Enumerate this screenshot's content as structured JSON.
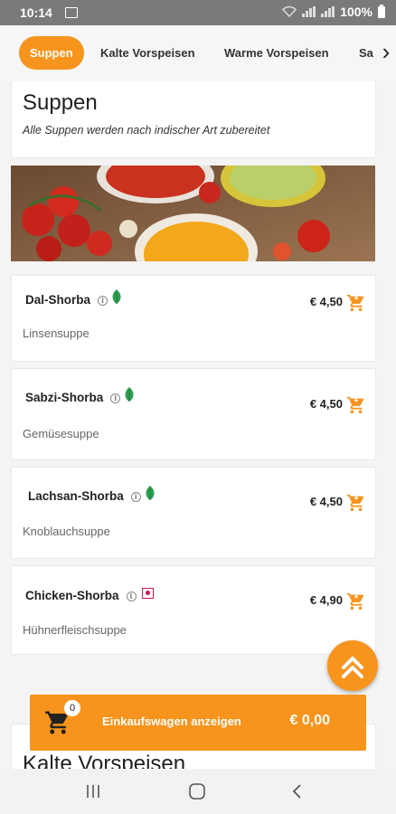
{
  "status": {
    "time": "10:14",
    "battery": "100%"
  },
  "tabs": [
    "Suppen",
    "Kalte Vorspeisen",
    "Warme Vorspeisen",
    "Sa"
  ],
  "section": {
    "title": "Suppen",
    "subtitle": "Alle Suppen werden nach indischer Art zubereitet"
  },
  "items": [
    {
      "name": "Dal-Shorba",
      "desc": "Linsensuppe",
      "price": "€ 4,50",
      "badge": "veg-leaf-icon"
    },
    {
      "name": "Sabzi-Shorba",
      "desc": "Gemüsesuppe",
      "price": "€ 4,50",
      "badge": "veg-leaf-icon"
    },
    {
      "name": "Lachsan-Shorba",
      "desc": "Knoblauchsuppe",
      "price": "€ 4,50",
      "badge": "veg-leaf-icon"
    },
    {
      "name": "Chicken-Shorba",
      "desc": "Hühnerfleischsuppe",
      "price": "€ 4,90",
      "badge": "non-veg-icon"
    }
  ],
  "next_section": {
    "title": "Kalte Vorspeisen"
  },
  "cart": {
    "count": "0",
    "label": "Einkaufswagen anzeigen",
    "total": "€ 0,00"
  },
  "colors": {
    "accent": "#f7941d",
    "veg": "#2e9e4f",
    "nonveg": "#c2185b"
  }
}
